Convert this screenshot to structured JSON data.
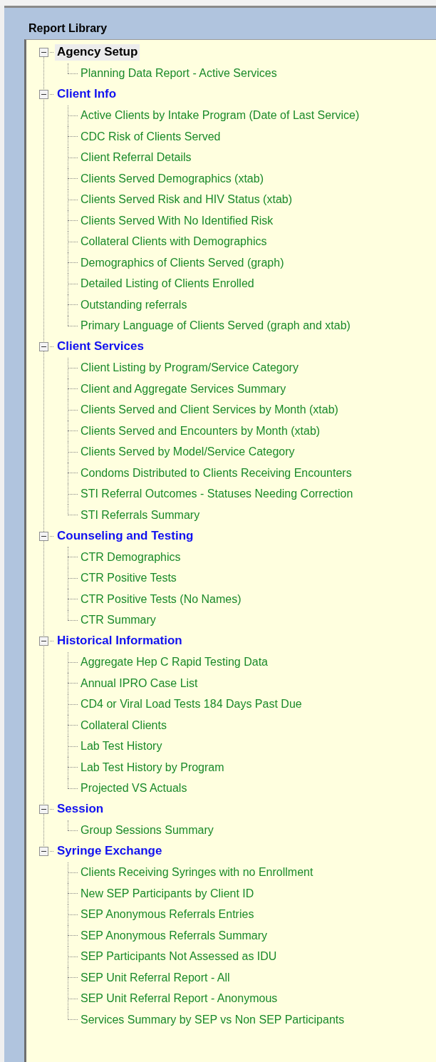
{
  "panel": {
    "title": "Report Library"
  },
  "groups": [
    {
      "label": "Agency Setup",
      "selected": true,
      "expanded": true,
      "children": [
        {
          "label": "Planning Data Report - Active Services"
        }
      ]
    },
    {
      "label": "Client Info",
      "selected": false,
      "expanded": true,
      "children": [
        {
          "label": "Active Clients by Intake Program (Date of Last Service)"
        },
        {
          "label": "CDC Risk of Clients Served"
        },
        {
          "label": "Client Referral Details"
        },
        {
          "label": "Clients Served Demographics (xtab)"
        },
        {
          "label": "Clients Served Risk and HIV Status (xtab)"
        },
        {
          "label": "Clients Served With No Identified Risk"
        },
        {
          "label": "Collateral Clients with Demographics"
        },
        {
          "label": "Demographics of Clients Served (graph)"
        },
        {
          "label": "Detailed Listing of Clients Enrolled"
        },
        {
          "label": "Outstanding referrals"
        },
        {
          "label": "Primary Language of Clients Served (graph and xtab)"
        }
      ]
    },
    {
      "label": "Client Services",
      "selected": false,
      "expanded": true,
      "children": [
        {
          "label": "Client Listing by Program/Service Category"
        },
        {
          "label": "Client and Aggregate Services Summary"
        },
        {
          "label": "Clients Served and Client Services by Month (xtab)"
        },
        {
          "label": "Clients Served and Encounters by Month (xtab)"
        },
        {
          "label": "Clients Served by Model/Service Category"
        },
        {
          "label": "Condoms Distributed to Clients Receiving Encounters"
        },
        {
          "label": "STI Referral Outcomes - Statuses Needing Correction"
        },
        {
          "label": "STI Referrals Summary"
        }
      ]
    },
    {
      "label": "Counseling and Testing",
      "selected": false,
      "expanded": true,
      "children": [
        {
          "label": "CTR Demographics"
        },
        {
          "label": "CTR Positive Tests"
        },
        {
          "label": "CTR Positive Tests (No Names)"
        },
        {
          "label": "CTR Summary"
        }
      ]
    },
    {
      "label": "Historical Information",
      "selected": false,
      "expanded": true,
      "children": [
        {
          "label": "Aggregate Hep C Rapid Testing Data"
        },
        {
          "label": "Annual IPRO Case List"
        },
        {
          "label": "CD4 or Viral Load Tests 184 Days Past Due"
        },
        {
          "label": "Collateral Clients"
        },
        {
          "label": "Lab Test History"
        },
        {
          "label": "Lab Test History by Program"
        },
        {
          "label": "Projected VS Actuals"
        }
      ]
    },
    {
      "label": "Session",
      "selected": false,
      "expanded": true,
      "children": [
        {
          "label": "Group Sessions Summary"
        }
      ]
    },
    {
      "label": "Syringe Exchange",
      "selected": false,
      "expanded": true,
      "children": [
        {
          "label": "Clients Receiving Syringes with no Enrollment"
        },
        {
          "label": "New SEP Participants by Client ID"
        },
        {
          "label": "SEP Anonymous Referrals Entries"
        },
        {
          "label": "SEP Anonymous Referrals Summary"
        },
        {
          "label": "SEP Participants Not Assessed as IDU"
        },
        {
          "label": "SEP Unit Referral Report - All"
        },
        {
          "label": "SEP Unit Referral Report - Anonymous"
        },
        {
          "label": "Services Summary by SEP vs Non SEP Participants"
        }
      ]
    }
  ]
}
